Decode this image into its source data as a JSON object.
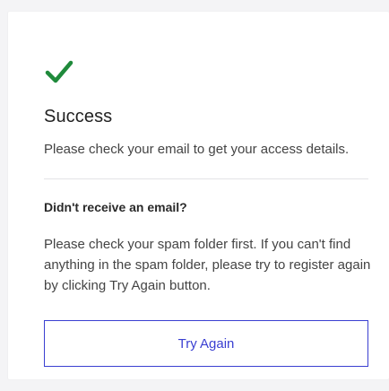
{
  "colors": {
    "success": "#1f8a3b",
    "accent": "#3a3fd1",
    "background": "#f4f4f6",
    "card": "#ffffff"
  },
  "icon": "checkmark-icon",
  "success": {
    "title": "Success",
    "message": "Please check your email to get your access details."
  },
  "help": {
    "question": "Didn't receive an email?",
    "message": "Please check your spam folder first. If you can't find anything in the spam folder, please try to register again by clicking Try Again button."
  },
  "actions": {
    "try_again_label": "Try Again"
  }
}
